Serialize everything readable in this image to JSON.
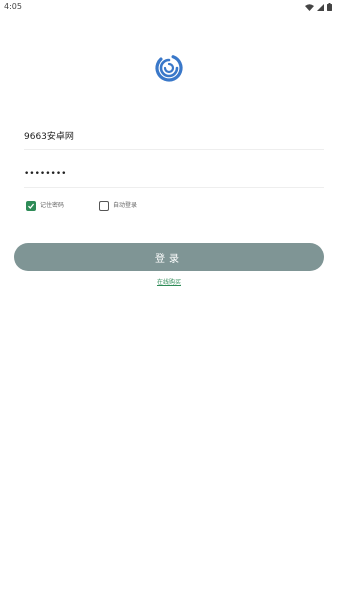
{
  "status_bar": {
    "time": "4:05",
    "icons": [
      "wifi-icon",
      "signal-icon",
      "battery-icon"
    ]
  },
  "logo": {
    "icon": "spiral-logo-icon",
    "color": "#3a78c9"
  },
  "form": {
    "username_value": "9663安卓网",
    "password_value": "••••••••",
    "remember_password_label": "记住密码",
    "remember_password_checked": true,
    "auto_login_label": "自动登录",
    "auto_login_checked": false,
    "login_button_label": "登录",
    "buy_link_label": "在线购买"
  },
  "colors": {
    "accent_green": "#2e8b57",
    "button_bg": "#7f9595",
    "logo_blue": "#3a78c9"
  }
}
